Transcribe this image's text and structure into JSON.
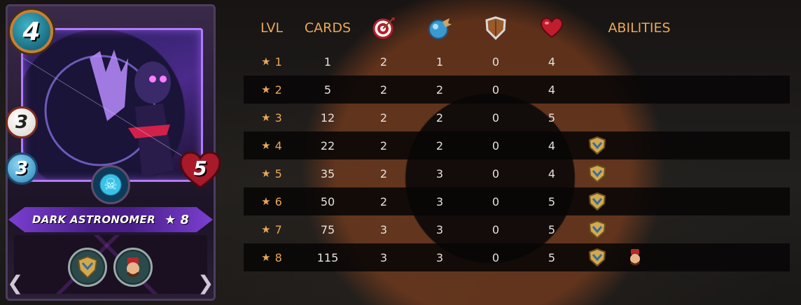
{
  "card": {
    "name": "DARK ASTRONOMER",
    "mana": "4",
    "ranged_attack": "3",
    "speed": "3",
    "health": "5",
    "level_label": "★ 8",
    "abilities": [
      "void-armor-icon",
      "reflection-icon"
    ]
  },
  "table": {
    "headers": {
      "lvl": "LVL",
      "cards": "CARDS",
      "ranged_icon": "ranged-attack-icon",
      "speed_icon": "speed-icon",
      "armor_icon": "armor-icon",
      "health_icon": "health-icon",
      "abilities": "ABILITIES"
    },
    "rows": [
      {
        "lvl": "1",
        "cards": "1",
        "ranged": "2",
        "speed": "1",
        "armor": "0",
        "health": "4",
        "abilities": []
      },
      {
        "lvl": "2",
        "cards": "5",
        "ranged": "2",
        "speed": "2",
        "armor": "0",
        "health": "4",
        "abilities": []
      },
      {
        "lvl": "3",
        "cards": "12",
        "ranged": "2",
        "speed": "2",
        "armor": "0",
        "health": "5",
        "abilities": []
      },
      {
        "lvl": "4",
        "cards": "22",
        "ranged": "2",
        "speed": "2",
        "armor": "0",
        "health": "4",
        "abilities": [
          "ability-shield-icon"
        ]
      },
      {
        "lvl": "5",
        "cards": "35",
        "ranged": "2",
        "speed": "3",
        "armor": "0",
        "health": "4",
        "abilities": [
          "ability-shield-icon"
        ]
      },
      {
        "lvl": "6",
        "cards": "50",
        "ranged": "2",
        "speed": "3",
        "armor": "0",
        "health": "5",
        "abilities": [
          "ability-shield-icon"
        ]
      },
      {
        "lvl": "7",
        "cards": "75",
        "ranged": "3",
        "speed": "3",
        "armor": "0",
        "health": "5",
        "abilities": [
          "ability-shield-icon"
        ]
      },
      {
        "lvl": "8",
        "cards": "115",
        "ranged": "3",
        "speed": "3",
        "armor": "0",
        "health": "5",
        "abilities": [
          "ability-shield-icon",
          "ability-fez-icon"
        ]
      }
    ]
  },
  "colors": {
    "header_text": "#e9a857",
    "row_text": "#e6e1dc",
    "dark_row": "#080606",
    "card_accent": "#b27bff"
  }
}
